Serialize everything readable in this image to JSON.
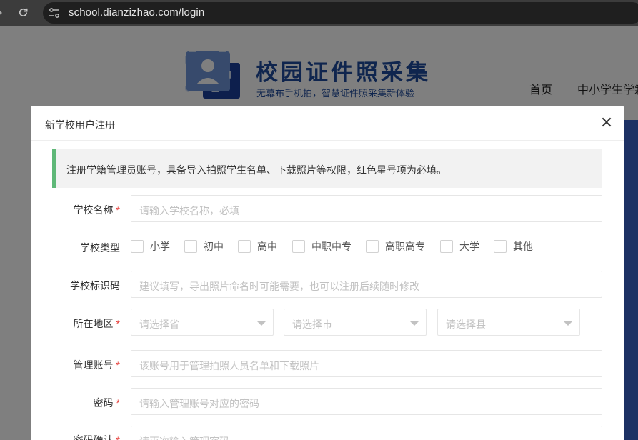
{
  "browser": {
    "url": "school.dianzizhao.com/login"
  },
  "site": {
    "title": "校园证件照采集",
    "subtitle": "无幕布手机拍，智慧证件照采集新体验",
    "nav": [
      "首页",
      "中小学生学籍"
    ]
  },
  "modal": {
    "title": "新学校用户注册",
    "notice": "注册学籍管理员账号，具备导入拍照学生名单、下载照片等权限，红色星号项为必填。",
    "required_mark": "*",
    "fields": {
      "school_name": {
        "label": "学校名称",
        "placeholder": "请输入学校名称，必填",
        "required": true
      },
      "school_type": {
        "label": "学校类型",
        "options": [
          "小学",
          "初中",
          "高中",
          "中职中专",
          "高职高专",
          "大学",
          "其他"
        ]
      },
      "school_code": {
        "label": "学校标识码",
        "placeholder": "建议填写，导出照片命名时可能需要，也可以注册后续随时修改"
      },
      "region": {
        "label": "所在地区",
        "required": true,
        "province_placeholder": "请选择省",
        "city_placeholder": "请选择市",
        "county_placeholder": "请选择县"
      },
      "admin_account": {
        "label": "管理账号",
        "placeholder": "该账号用于管理拍照人员名单和下载照片",
        "required": true
      },
      "password": {
        "label": "密码",
        "placeholder": "请输入管理账号对应的密码",
        "required": true
      },
      "password_confirm": {
        "label": "密码确认",
        "placeholder": "请再次输入管理密码",
        "required": true
      }
    }
  },
  "colors": {
    "brand": "#1e4a9c",
    "notice_accent": "#5fb878",
    "required": "#e53935"
  }
}
